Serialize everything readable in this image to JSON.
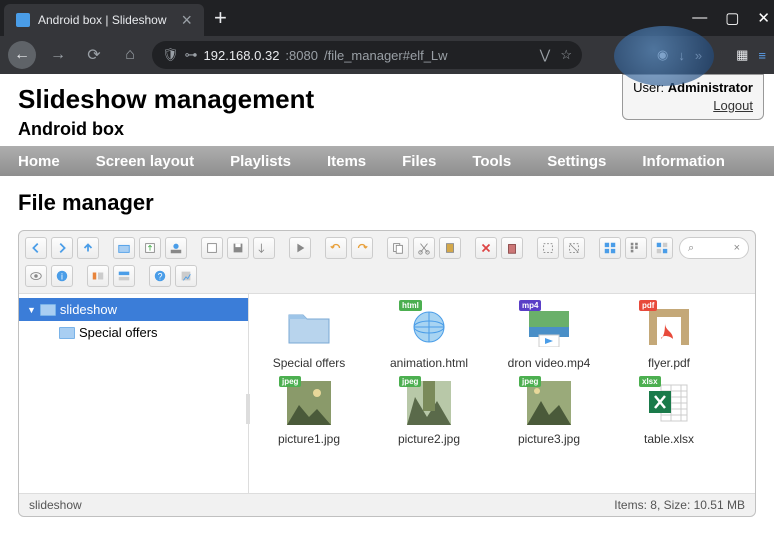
{
  "browser": {
    "tab_title": "Android box | Slideshow",
    "url_host": "192.168.0.32",
    "url_port": ":8080",
    "url_path": "/file_manager#elf_Lw"
  },
  "user_panel": {
    "user_label": "User:",
    "username": "Administrator",
    "logout": "Logout"
  },
  "titles": {
    "main": "Slideshow management",
    "sub": "Android box"
  },
  "nav": {
    "items": [
      "Home",
      "Screen layout",
      "Playlists",
      "Items",
      "Files",
      "Tools",
      "Settings",
      "Information"
    ]
  },
  "page_heading": "File manager",
  "tree": {
    "root": "slideshow",
    "children": [
      "Special offers"
    ]
  },
  "files": [
    {
      "name": "Special offers",
      "type": "folder"
    },
    {
      "name": "animation.html",
      "type": "html",
      "badge": "html"
    },
    {
      "name": "dron video.mp4",
      "type": "mp4",
      "badge": "mp4"
    },
    {
      "name": "flyer.pdf",
      "type": "pdf",
      "badge": "pdf"
    },
    {
      "name": "picture1.jpg",
      "type": "jpeg",
      "badge": "jpeg"
    },
    {
      "name": "picture2.jpg",
      "type": "jpeg",
      "badge": "jpeg"
    },
    {
      "name": "picture3.jpg",
      "type": "jpeg",
      "badge": "jpeg"
    },
    {
      "name": "table.xlsx",
      "type": "xlsx",
      "badge": "xlsx"
    }
  ],
  "status": {
    "path": "slideshow",
    "summary": "Items: 8, Size: 10.51 MB"
  },
  "icons": {
    "lock": "⊶",
    "shield": "🛡",
    "star": "☆",
    "user": "◉",
    "download": "↓",
    "more": "»",
    "gift": "▦",
    "menu": "≡"
  }
}
